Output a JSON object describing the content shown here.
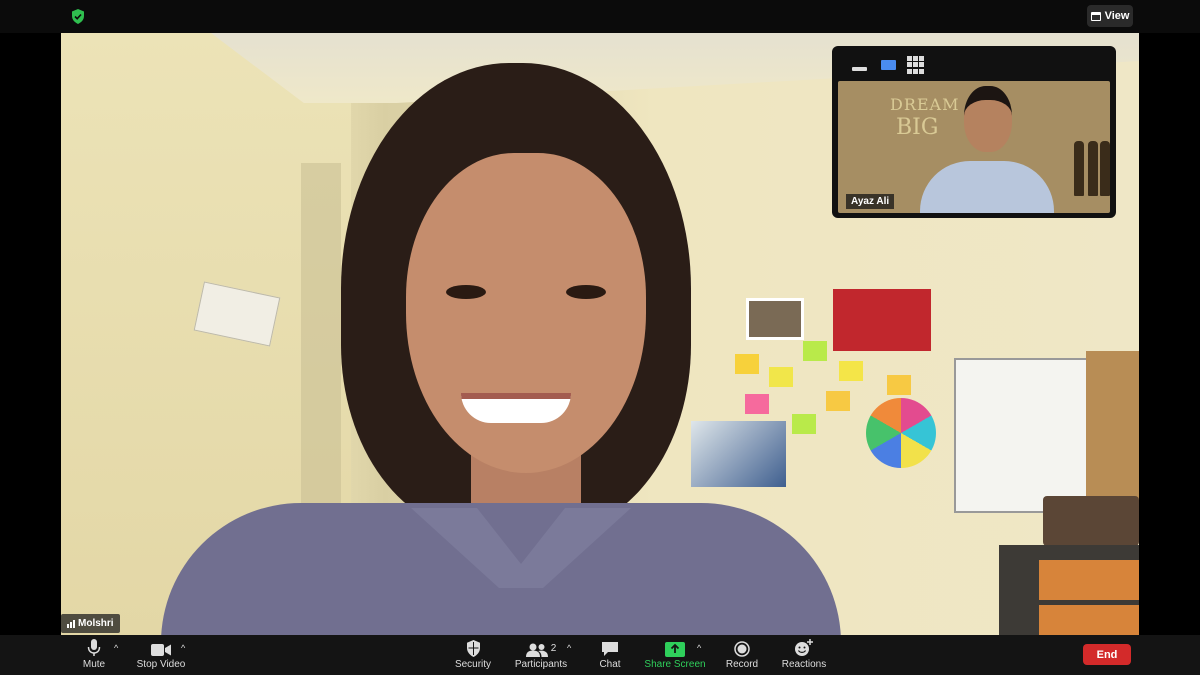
{
  "top_bar": {
    "security_status_icon": "shield-check-icon",
    "view_label": "View"
  },
  "main_video": {
    "participant_name": "Molshri"
  },
  "thumbnail": {
    "participant_name": "Ayaz Ali",
    "wall_text_line1": "DREAM",
    "wall_text_line2": "BIG",
    "controls": [
      "minimize-icon",
      "speaker-view-icon",
      "gallery-view-icon"
    ]
  },
  "toolbar": {
    "mute_label": "Mute",
    "stop_video_label": "Stop Video",
    "security_label": "Security",
    "participants_label": "Participants",
    "participants_count": "2",
    "chat_label": "Chat",
    "share_screen_label": "Share Screen",
    "record_label": "Record",
    "reactions_label": "Reactions",
    "end_label": "End"
  },
  "colors": {
    "share_green": "#2fcf5b",
    "end_red": "#d32a2a",
    "shield_green": "#2fbf4f",
    "active_view_blue": "#4a8cf0"
  }
}
